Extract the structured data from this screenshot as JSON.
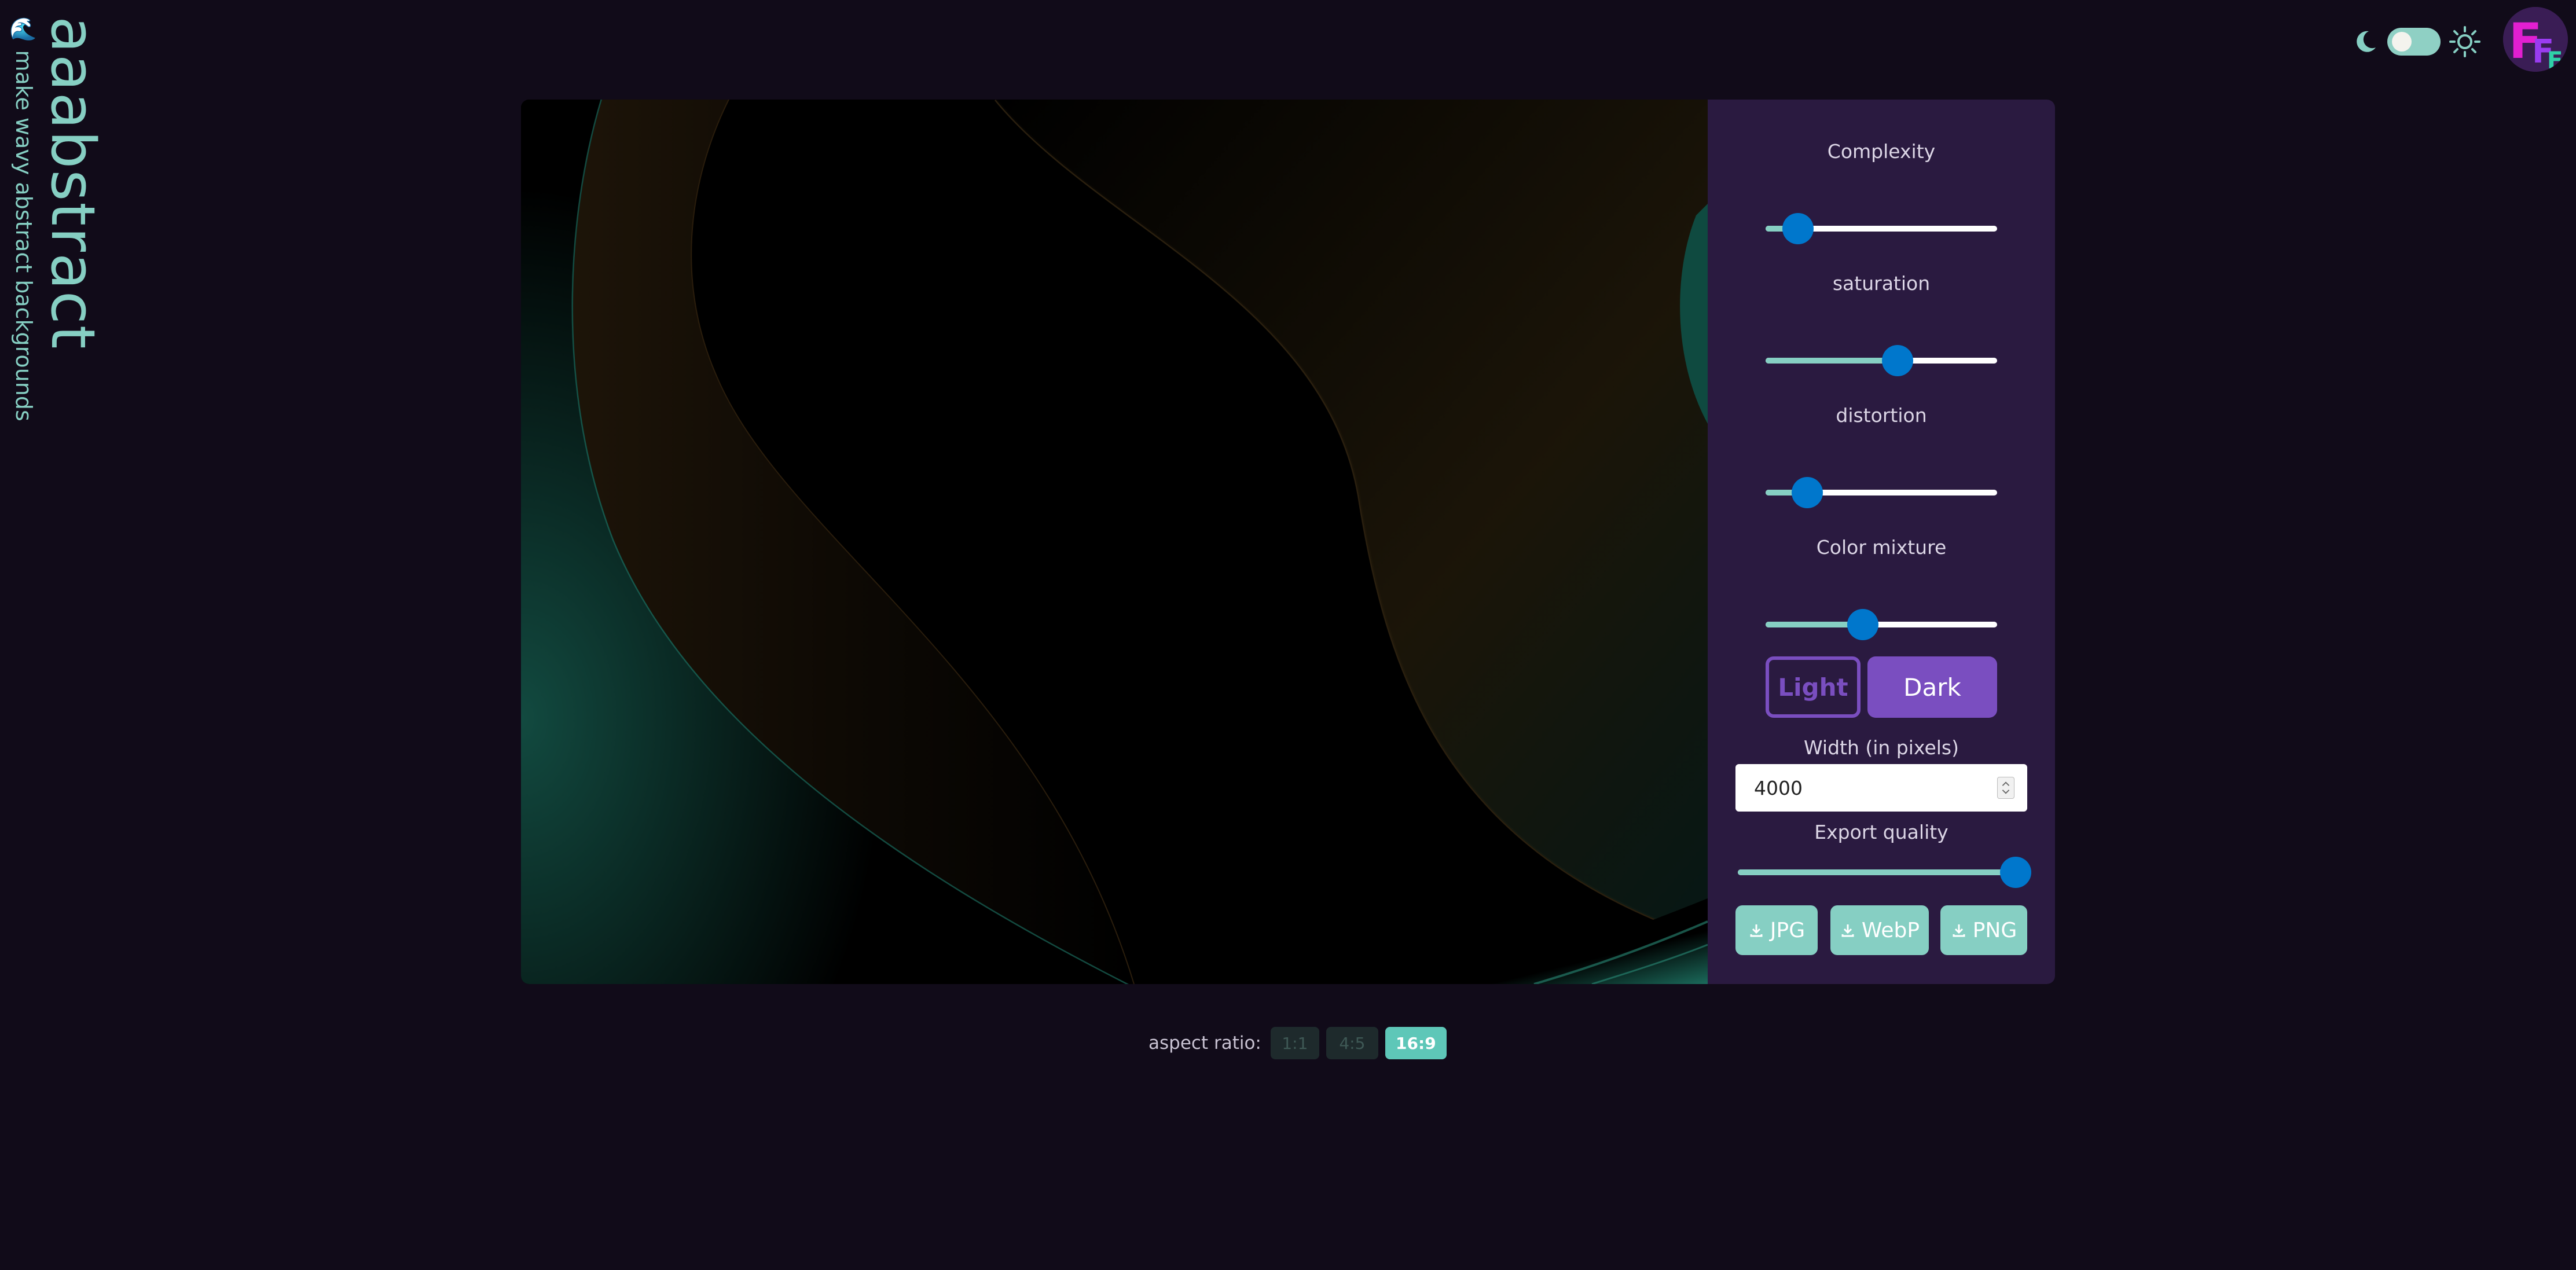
{
  "brand": {
    "title": "aaabstract",
    "subtitle": "make wavy abstract backgrounds",
    "icon": "wave-icon"
  },
  "header": {
    "theme_toggle": {
      "left_icon": "moon-icon",
      "right_icon": "sun-icon",
      "state": "dark"
    },
    "avatar_icon": "fff-logo"
  },
  "panel": {
    "sliders": [
      {
        "label": "Complexity",
        "value": 0.14
      },
      {
        "label": "saturation",
        "value": 0.57
      },
      {
        "label": "distortion",
        "value": 0.18
      },
      {
        "label": "Color mixture",
        "value": 0.42
      }
    ],
    "mode_light_label": "Light",
    "mode_dark_label": "Dark",
    "mode_selected": "Dark",
    "width_label": "Width (in pixels)",
    "width_value": "4000",
    "export_quality_label": "Export quality",
    "export_quality_value": 1.0,
    "export_buttons": [
      {
        "label": "JPG",
        "icon": "download-icon"
      },
      {
        "label": "WebP",
        "icon": "download-icon"
      },
      {
        "label": "PNG",
        "icon": "download-icon"
      }
    ]
  },
  "aspect": {
    "label": "aspect ratio:",
    "options": [
      "1:1",
      "4:5",
      "16:9"
    ],
    "selected": "16:9"
  },
  "colors": {
    "background": "#110b19",
    "panel": "#2a1a40",
    "accent_teal": "#86cfc3",
    "accent_purple": "#7a4ec0",
    "slider_thumb": "#0077cc"
  }
}
